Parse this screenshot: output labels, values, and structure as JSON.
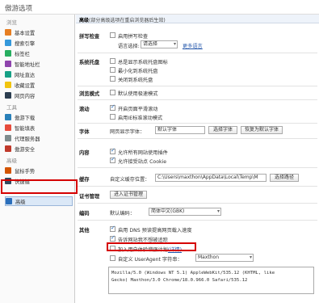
{
  "window": {
    "title": "傲游选项"
  },
  "sidebar": {
    "sections": [
      {
        "label": "浏览",
        "items": [
          {
            "label": "基本设置",
            "icon": "home-icon",
            "color": "#e67e22"
          },
          {
            "label": "搜索引擎",
            "icon": "search-icon",
            "color": "#3498db"
          },
          {
            "label": "标签栏",
            "icon": "tab-icon",
            "color": "#27ae60"
          },
          {
            "label": "智能地址栏",
            "icon": "addressbar-icon",
            "color": "#8e44ad"
          },
          {
            "label": "网址直达",
            "icon": "url-icon",
            "color": "#16a085"
          },
          {
            "label": "收藏设置",
            "icon": "star-icon",
            "color": "#f1c40f"
          },
          {
            "label": "网页内容",
            "icon": "page-icon",
            "color": "#2c3e50"
          }
        ]
      },
      {
        "label": "工具",
        "items": [
          {
            "label": "傲游下载",
            "icon": "download-icon",
            "color": "#2980b9"
          },
          {
            "label": "智能填表",
            "icon": "form-icon",
            "color": "#e74c3c"
          },
          {
            "label": "代理服务器",
            "icon": "proxy-icon",
            "color": "#7f8c8d"
          },
          {
            "label": "傲游安全",
            "icon": "shield-icon",
            "color": "#c0392b"
          }
        ]
      },
      {
        "label": "高级",
        "items": [
          {
            "label": "鼠标手势",
            "icon": "mouse-icon",
            "color": "#d35400"
          },
          {
            "label": "快捷键",
            "icon": "keyboard-icon",
            "color": "#34495e"
          },
          {
            "label": "高级",
            "icon": "advanced-icon",
            "color": "#2a6ebb"
          }
        ]
      }
    ]
  },
  "notice": {
    "bold": "高级",
    "text": "(部分高级选项在重启浏览器后生效)"
  },
  "spellcheck": {
    "label": "拼写检查",
    "enable": "启用拼写检查",
    "lang_label": "语言选择:",
    "lang_value": "请选择",
    "more_link": "更多语言"
  },
  "tray": {
    "label": "系统托盘",
    "opts": [
      "总是显示系统托盘图标",
      "最小化到系统托盘",
      "关闭到系统托盘"
    ]
  },
  "browse_mode": {
    "label": "浏览模式",
    "opt": "默认使用极速模式"
  },
  "scroll": {
    "label": "滚动",
    "opts": [
      "开启页面平滑滚动",
      "启用IE标准滚动模式"
    ]
  },
  "font": {
    "label": "字体",
    "web_font_label": "网页显示字体：",
    "web_font_value": "默认字体",
    "choose_btn": "选择字体",
    "restore_btn": "恢复为默认字体"
  },
  "content": {
    "label": "内容",
    "opts": [
      "允许所有网站使用插件",
      "允许接受站点 Cookie"
    ]
  },
  "cache": {
    "label": "缓存",
    "dir_label": "自定义缓存位置：",
    "dir_value": "C:\\Users\\maxthon\\AppData\\Local\\Temp\\M",
    "choose_btn": "选择路径"
  },
  "cert": {
    "label": "证书管理",
    "btn": "进入证书管理"
  },
  "encoding": {
    "label": "编码",
    "default_label": "默认编码：",
    "default_value": "简体中文(GBK)"
  },
  "other": {
    "label": "其他",
    "opts": [
      "启用 DNS 预读提高网页载入速度",
      "告诉网站我不想被追踪",
      "加入用户体验增强计划",
      "自定义 UserAgent 字符串："
    ],
    "detail_link": "(详情)",
    "ua_select": "Maxthon",
    "ua_text": "Mozilla/5.0 (Windows NT 5.1) AppleWebKit/535.12 (KHTML, like\nGecko) Maxthon/3.0 Chrome/18.0.966.0 Safari/535.12"
  },
  "colors": {
    "highlight": "#d50000",
    "accent": "#2a6ebb"
  }
}
